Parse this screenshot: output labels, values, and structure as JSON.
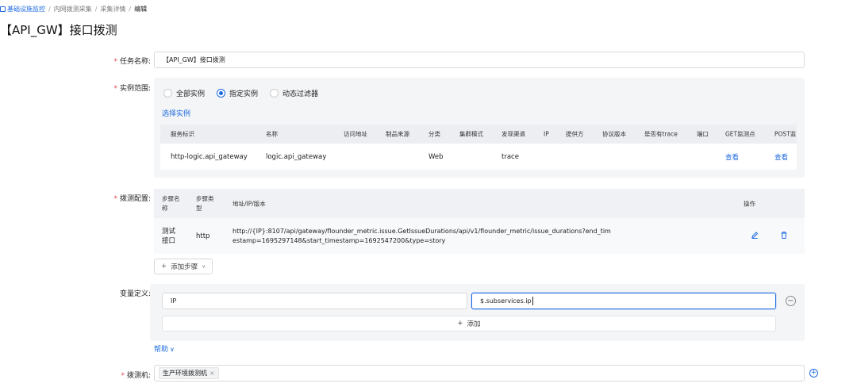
{
  "breadcrumb": {
    "items": [
      "基础设施监控",
      "内网拨测采集",
      "采集详情"
    ],
    "current": "编辑"
  },
  "page_title": "【API_GW】接口拨测",
  "form": {
    "task_name": {
      "label": "任务名称:",
      "value": "【API_GW】接口拨测"
    },
    "instance_scope": {
      "label": "实例范围:",
      "options": [
        "全部实例",
        "指定实例",
        "动态过滤器"
      ],
      "selected": "指定实例",
      "select_link": "选择实例",
      "table": {
        "headers": [
          "服务标识",
          "名称",
          "访问地址",
          "制品来源",
          "分类",
          "集群模式",
          "发现渠道",
          "IP",
          "提供方",
          "协议版本",
          "是否有trace",
          "端口",
          "GET监测点",
          "POST监"
        ],
        "rows": [
          {
            "service_id": "http-logic.api_gateway",
            "name": "logic.api_gateway",
            "access": "",
            "artifact": "",
            "category": "Web",
            "cluster": "",
            "discovery": "trace",
            "ip": "",
            "provider": "",
            "protocol": "",
            "has_trace": "",
            "port": "",
            "get_link": "查看",
            "post_link": "查看"
          }
        ]
      }
    },
    "probe_config": {
      "label": "拨测配置:",
      "headers": {
        "step_name": "步骤名称",
        "step_type": "步骤类型",
        "address": "地址/IP/版本",
        "action": "操作"
      },
      "rows": [
        {
          "step_name": "测试接口",
          "step_type": "http",
          "address": "http://{IP}:8107/api/gateway/flounder_metric.issue.GetIssueDurations/api/v1/flounder_metric/issue_durations?end_timestamp=1695297148&start_timestamp=1692547200&type=story"
        }
      ],
      "add_step": "添加步骤"
    },
    "variables": {
      "label": "变量定义:",
      "rows": [
        {
          "key": "IP",
          "value": "$.subservices.ip"
        }
      ],
      "add_label": "添加"
    },
    "help_link": "帮助",
    "prober": {
      "label": "拨测机:",
      "tags": [
        "生产环境拨测机"
      ]
    }
  },
  "colors": {
    "accent": "#1e6ae0",
    "required": "#e5484d",
    "panel": "#f4f5f7"
  }
}
